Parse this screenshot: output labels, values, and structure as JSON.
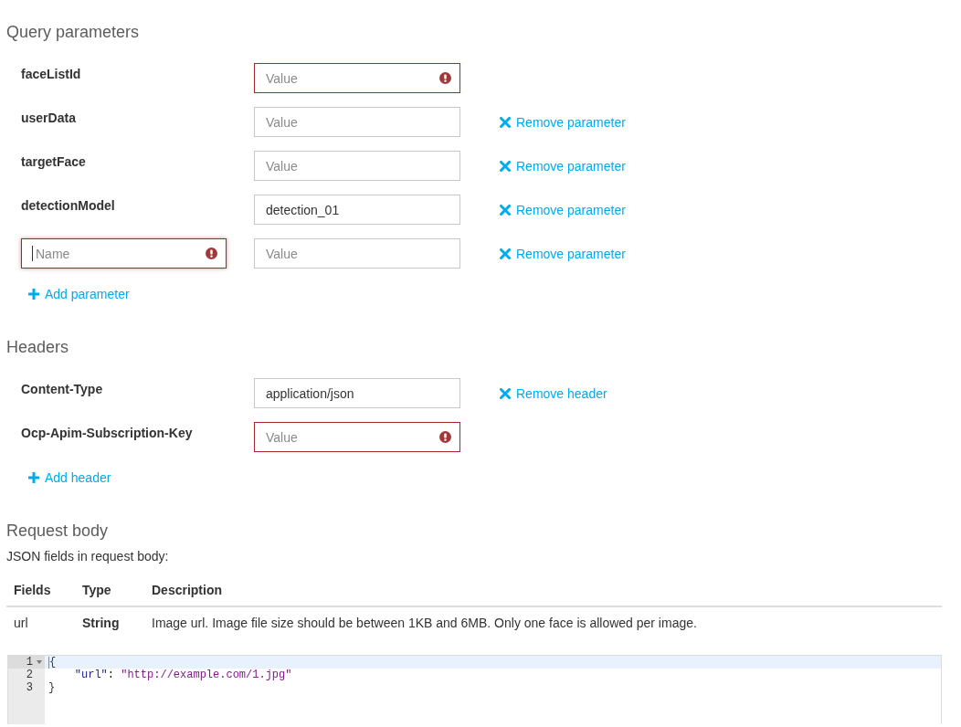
{
  "query_parameters": {
    "title": "Query parameters",
    "rows": [
      {
        "kind": "fixed",
        "name": "faceListId",
        "value_field": {
          "placeholder": "Value",
          "error": true
        }
      },
      {
        "kind": "fixed",
        "name": "userData",
        "value_field": {
          "placeholder": "Value",
          "error": false
        },
        "remove": "Remove parameter"
      },
      {
        "kind": "fixed",
        "name": "targetFace",
        "value_field": {
          "placeholder": "Value",
          "error": false
        },
        "remove": "Remove parameter"
      },
      {
        "kind": "fixed",
        "name": "detectionModel",
        "value_field": {
          "value": "detection_01",
          "error": false
        },
        "remove": "Remove parameter"
      },
      {
        "kind": "custom",
        "name_field": {
          "placeholder": "Name",
          "error": true,
          "focused": true
        },
        "value_field": {
          "placeholder": "Value",
          "error": false
        },
        "remove": "Remove parameter"
      }
    ],
    "add": "Add parameter"
  },
  "headers": {
    "title": "Headers",
    "rows": [
      {
        "kind": "fixed",
        "name": "Content-Type",
        "value_field": {
          "value": "application/json",
          "error": false
        },
        "remove": "Remove header"
      },
      {
        "kind": "fixed",
        "name": "Ocp-Apim-Subscription-Key",
        "value_field": {
          "placeholder": "Value",
          "error": true
        }
      }
    ],
    "add": "Add header"
  },
  "request_body": {
    "title": "Request body",
    "caption": "JSON fields in request body:",
    "table": {
      "columns": [
        "Fields",
        "Type",
        "Description"
      ],
      "rows": [
        [
          "url",
          "String",
          "Image url. Image file size should be between 1KB and 6MB. Only one face is allowed per image."
        ]
      ]
    },
    "editor": {
      "lines": [
        {
          "number": "1",
          "foldable": true,
          "active": true,
          "indented": false,
          "tokens": [
            {
              "kind": "paren",
              "text": "{"
            }
          ]
        },
        {
          "number": "2",
          "foldable": false,
          "active": false,
          "indented": true,
          "tokens": [
            {
              "kind": "key",
              "text": "\"url\""
            },
            {
              "kind": "punct",
              "text": ": "
            },
            {
              "kind": "string",
              "text": "\"http://example.com/1.jpg\""
            }
          ]
        },
        {
          "number": "3",
          "foldable": false,
          "active": false,
          "indented": false,
          "tokens": [
            {
              "kind": "paren",
              "text": "}"
            }
          ]
        }
      ]
    }
  }
}
